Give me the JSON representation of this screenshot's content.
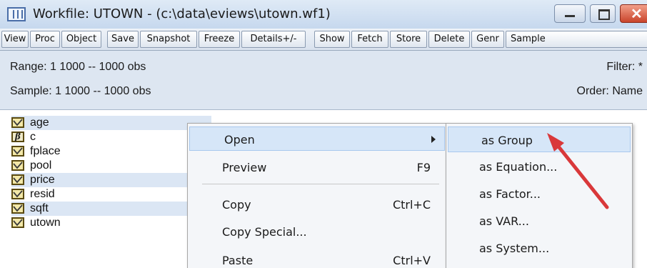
{
  "window": {
    "title": "Workfile: UTOWN - (c:\\data\\eviews\\utown.wf1)",
    "icon": "workfile-icon",
    "controls": {
      "minimize": "minimize-icon",
      "maximize": "maximize-icon",
      "close": "✕"
    }
  },
  "toolbar": {
    "buttons": [
      "View",
      "Proc",
      "Object",
      "Save",
      "Snapshot",
      "Freeze",
      "Details+/-",
      "Show",
      "Fetch",
      "Store",
      "Delete",
      "Genr",
      "Sample"
    ]
  },
  "info": {
    "range": "Range:  1 1000  --  1000 obs",
    "sample": "Sample: 1 1000  --  1000 obs",
    "filter": "Filter: *",
    "order": "Order: Name"
  },
  "objects": [
    {
      "name": "age",
      "icon": "series-icon",
      "selected": true
    },
    {
      "name": "c",
      "icon": "coefficient-icon",
      "selected": false
    },
    {
      "name": "fplace",
      "icon": "series-icon",
      "selected": false
    },
    {
      "name": "pool",
      "icon": "series-icon",
      "selected": false
    },
    {
      "name": "price",
      "icon": "series-icon",
      "selected": true
    },
    {
      "name": "resid",
      "icon": "series-icon",
      "selected": false
    },
    {
      "name": "sqft",
      "icon": "series-icon",
      "selected": true
    },
    {
      "name": "utown",
      "icon": "series-icon",
      "selected": false
    }
  ],
  "context_menu": {
    "items": [
      {
        "label": "Open",
        "shortcut": "",
        "submenu": true
      },
      {
        "label": "Preview",
        "shortcut": "F9"
      },
      {
        "label": "Copy",
        "shortcut": "Ctrl+C"
      },
      {
        "label": "Copy Special...",
        "shortcut": ""
      },
      {
        "label": "Paste",
        "shortcut": "Ctrl+V"
      }
    ]
  },
  "submenu": {
    "items": [
      "as Group",
      "as Equation...",
      "as Factor...",
      "as VAR...",
      "as System..."
    ]
  },
  "colors": {
    "annotation_arrow": "#d9383a",
    "selection": "#dbe6f4",
    "menu_highlight": "#d6e6f8"
  }
}
